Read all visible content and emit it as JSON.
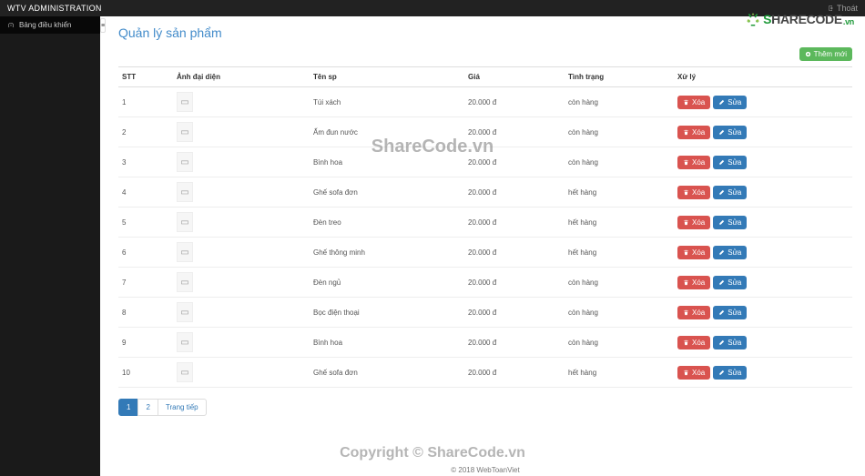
{
  "topbar": {
    "brand": "WTV ADMINISTRATION",
    "logout_label": "Thoát"
  },
  "sidebar": {
    "items": [
      {
        "label": "Bảng điều khiển"
      }
    ]
  },
  "page": {
    "title": "Quản lý sản phẩm",
    "add_button": "Thêm mới"
  },
  "table": {
    "headers": {
      "stt": "STT",
      "image": "Ảnh đại diện",
      "name": "Tên sp",
      "price": "Giá",
      "status": "Tình trạng",
      "actions": "Xử lý"
    },
    "rows": [
      {
        "stt": "1",
        "name": "Túi xách",
        "price": "20.000 đ",
        "status": "còn hàng"
      },
      {
        "stt": "2",
        "name": "Ấm đun nước",
        "price": "20.000 đ",
        "status": "còn hàng"
      },
      {
        "stt": "3",
        "name": "Bình hoa",
        "price": "20.000 đ",
        "status": "còn hàng"
      },
      {
        "stt": "4",
        "name": "Ghế sofa đơn",
        "price": "20.000 đ",
        "status": "hết hàng"
      },
      {
        "stt": "5",
        "name": "Đèn treo",
        "price": "20.000 đ",
        "status": "hết hàng"
      },
      {
        "stt": "6",
        "name": "Ghế thông minh",
        "price": "20.000 đ",
        "status": "hết hàng"
      },
      {
        "stt": "7",
        "name": "Đèn ngủ",
        "price": "20.000 đ",
        "status": "còn hàng"
      },
      {
        "stt": "8",
        "name": "Bọc điện thoại",
        "price": "20.000 đ",
        "status": "còn hàng"
      },
      {
        "stt": "9",
        "name": "Bình hoa",
        "price": "20.000 đ",
        "status": "còn hàng"
      },
      {
        "stt": "10",
        "name": "Ghế sofa đơn",
        "price": "20.000 đ",
        "status": "hết hàng"
      }
    ],
    "action_labels": {
      "delete": "Xóa",
      "edit": "Sửa"
    }
  },
  "pagination": {
    "pages": [
      "1",
      "2"
    ],
    "active": "1",
    "next": "Trang tiếp"
  },
  "footer": {
    "text": "© 2018 WebToanViet"
  },
  "watermarks": {
    "logo_s": "S",
    "logo_hare": "HARE",
    "logo_code": "CODE",
    "logo_vn": ".vn",
    "center": "ShareCode.vn",
    "bottom": "Copyright © ShareCode.vn"
  }
}
